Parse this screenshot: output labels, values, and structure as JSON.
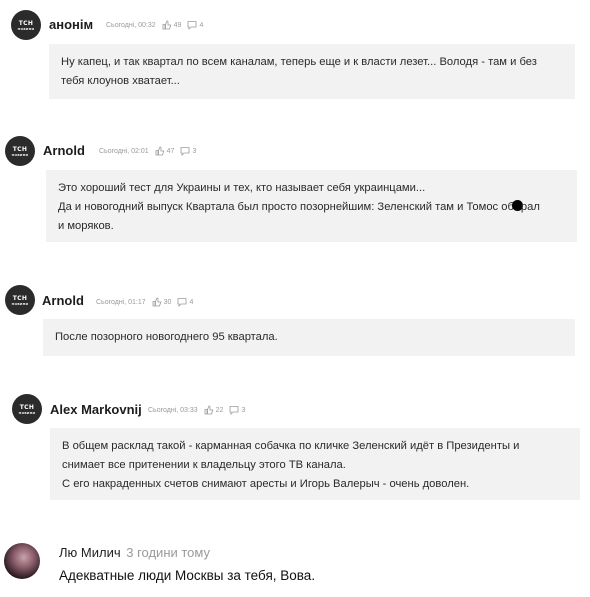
{
  "avatar_text": {
    "line1": "TCH",
    "line2": "НОВИНИ"
  },
  "comments": [
    {
      "author": "анонім",
      "time": "Сьогодні, 00:32",
      "likes": "49",
      "dislikes": "4",
      "lines": [
        "Ну капец, и так квартал по всем каналам, теперь еще и к власти лезет... Володя - там и без",
        "тебя клоунов хватает..."
      ]
    },
    {
      "author": "Arnold",
      "time": "Сьогодні, 02:01",
      "likes": "47",
      "dislikes": "3",
      "lines": [
        "Это хороший тест для Украины и тех, кто называет себя украинцами...",
        "Да и новогодний выпуск Квартала был просто позорнейшим: Зеленский там и Томос об",
        "рал",
        "и моряков."
      ]
    },
    {
      "author": "Arnold",
      "time": "Сьогодні, 01:17",
      "likes": "30",
      "dislikes": "4",
      "lines": [
        "После позорного новогоднего 95 квартала."
      ]
    },
    {
      "author": "Alex Markovnij",
      "time": "Сьогодні, 03:33",
      "likes": "22",
      "dislikes": "3",
      "lines": [
        "В общем расклад такой - карманная собачка по кличке Зеленский идёт в Президенты и",
        "снимает все притенении к владельцу этого ТВ канала.",
        "С его накраденных счетов снимают аресты и Игорь Валерыч - очень доволен."
      ]
    }
  ],
  "last_comment": {
    "author": "Лю Милич",
    "time": "3 години тому",
    "text": "Адекватные люди Москвы за тебя, Вова."
  }
}
